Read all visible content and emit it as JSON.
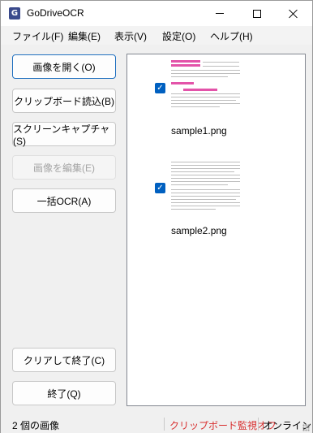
{
  "window": {
    "title": "GoDriveOCR",
    "app_icon_glyph": "G"
  },
  "menu": [
    "ファイル(F)",
    "編集(E)",
    "表示(V)",
    "設定(O)",
    "ヘルプ(H)"
  ],
  "buttons": {
    "open_image": "画像を開く(O)",
    "clipboard_read": "クリップボード読込(B)",
    "screen_capture": "スクリーンキャプチャ(S)",
    "edit_image": "画像を編集(E)",
    "batch_ocr": "一括OCR(A)",
    "clear_and_exit": "クリアして終了(C)",
    "exit": "終了(Q)"
  },
  "images": [
    {
      "filename": "sample1.png",
      "checked": true
    },
    {
      "filename": "sample2.png",
      "checked": true
    }
  ],
  "status": {
    "image_count": "2 個の画像",
    "clipboard_watch": "クリップボード監視オフ",
    "online": "オンライン"
  },
  "colors": {
    "accent": "#0060c0",
    "status_warning": "#d83030",
    "highlight": "#e040a0"
  }
}
